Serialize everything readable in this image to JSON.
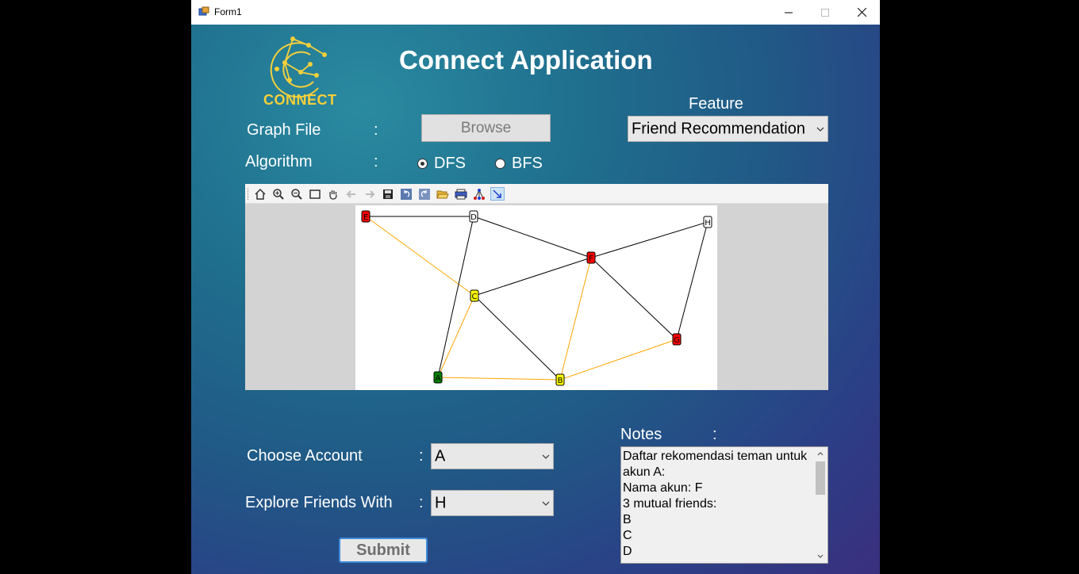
{
  "window": {
    "title": "Form1"
  },
  "header": {
    "app_title": "Connect Application",
    "logo_text": "CONNECT"
  },
  "graph_file": {
    "label": "Graph File",
    "colon": ":",
    "browse_label": "Browse"
  },
  "feature": {
    "label": "Feature",
    "selected": "Friend Recommendation"
  },
  "algorithm": {
    "label": "Algorithm",
    "colon": ":",
    "options": [
      {
        "label": "DFS",
        "checked": true
      },
      {
        "label": "BFS",
        "checked": false
      }
    ]
  },
  "toolbar": {
    "icons": [
      "home-icon",
      "zoom-in-icon",
      "zoom-out-icon",
      "zoom-window-icon",
      "pan-hand-icon",
      "back-arrow-icon",
      "forward-arrow-icon",
      "save-icon",
      "undo-icon",
      "redo-icon",
      "open-folder-icon",
      "print-icon",
      "layout-icon",
      "edge-tool-icon"
    ]
  },
  "graph": {
    "nodes": [
      {
        "id": "E",
        "label": "E",
        "color": "#ff0000"
      },
      {
        "id": "D",
        "label": "D",
        "color": "#ffffff"
      },
      {
        "id": "H",
        "label": "H",
        "color": "#ffffff"
      },
      {
        "id": "F",
        "label": "F",
        "color": "#ff0000"
      },
      {
        "id": "C",
        "label": "C",
        "color": "#ffff00"
      },
      {
        "id": "G",
        "label": "G",
        "color": "#ff0000"
      },
      {
        "id": "A",
        "label": "A",
        "color": "#008000"
      },
      {
        "id": "B",
        "label": "B",
        "color": "#ffff00"
      }
    ],
    "edges": [
      {
        "from": "E",
        "to": "D",
        "color": "#000000"
      },
      {
        "from": "E",
        "to": "C",
        "color": "#ffa500"
      },
      {
        "from": "D",
        "to": "A",
        "color": "#000000"
      },
      {
        "from": "D",
        "to": "F",
        "color": "#000000"
      },
      {
        "from": "F",
        "to": "H",
        "color": "#000000"
      },
      {
        "from": "H",
        "to": "G",
        "color": "#000000"
      },
      {
        "from": "F",
        "to": "G",
        "color": "#000000"
      },
      {
        "from": "F",
        "to": "C",
        "color": "#000000"
      },
      {
        "from": "F",
        "to": "B",
        "color": "#ffa500"
      },
      {
        "from": "C",
        "to": "A",
        "color": "#ffa500"
      },
      {
        "from": "C",
        "to": "B",
        "color": "#000000"
      },
      {
        "from": "A",
        "to": "B",
        "color": "#ffa500"
      },
      {
        "from": "B",
        "to": "G",
        "color": "#ffa500"
      }
    ]
  },
  "choose_account": {
    "label": "Choose Account",
    "colon": ":",
    "selected": "A"
  },
  "explore": {
    "label": "Explore Friends With",
    "colon": ":",
    "selected": "H"
  },
  "submit_label": "Submit",
  "notes": {
    "label": "Notes",
    "colon": ":",
    "lines": [
      "Daftar rekomendasi teman untuk",
      "akun A:",
      "Nama akun: F",
      "3 mutual friends:",
      "B",
      "C",
      "D"
    ]
  }
}
